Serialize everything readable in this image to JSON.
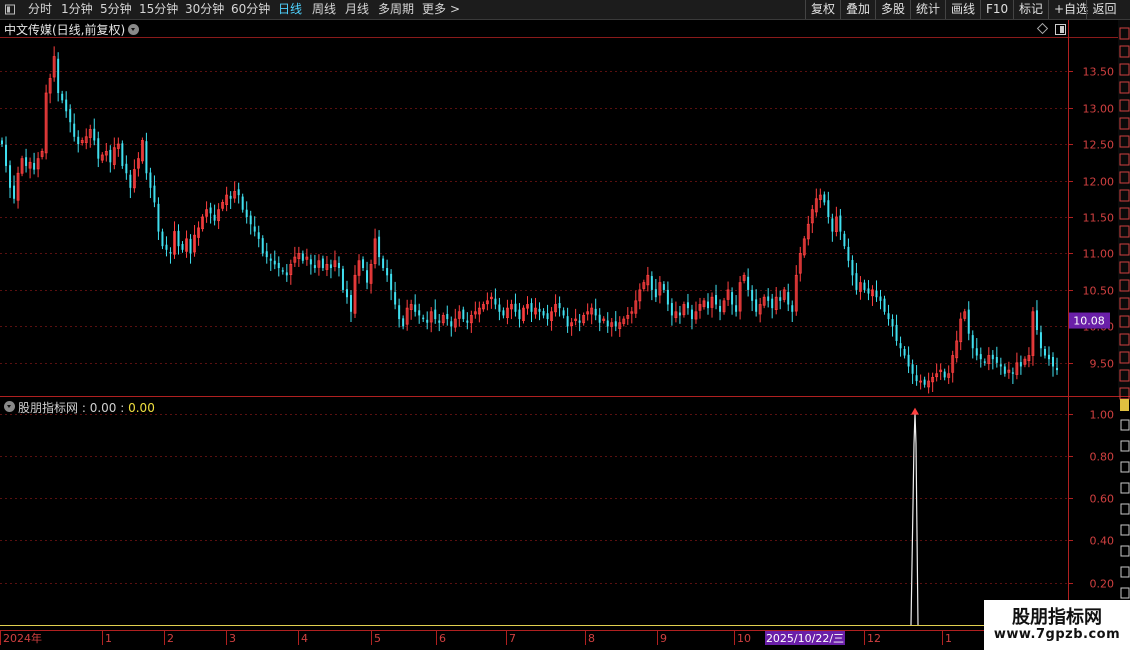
{
  "toolbar": {
    "periods": [
      {
        "label": "分时",
        "active": false
      },
      {
        "label": "1分钟",
        "active": false
      },
      {
        "label": "5分钟",
        "active": false
      },
      {
        "label": "15分钟",
        "active": false
      },
      {
        "label": "30分钟",
        "active": false
      },
      {
        "label": "60分钟",
        "active": false
      },
      {
        "label": "日线",
        "active": true
      },
      {
        "label": "周线",
        "active": false
      },
      {
        "label": "月线",
        "active": false
      },
      {
        "label": "多周期",
        "active": false
      },
      {
        "label": "更多",
        "active": false
      }
    ],
    "more_arrow": ">",
    "actions": [
      "复权",
      "叠加",
      "多股",
      "统计",
      "画线",
      "F10",
      "标记",
      "+自选",
      "返回"
    ]
  },
  "stock": {
    "title": "中文传媒(日线,前复权)"
  },
  "price_axis": {
    "ticks": [
      "13.50",
      "13.00",
      "12.50",
      "12.00",
      "11.50",
      "11.00",
      "10.50",
      "10.00",
      "9.50"
    ],
    "current_price": "10.08"
  },
  "indicator": {
    "name": "股朋指标网",
    "value1": "0.00",
    "value2": "0.00",
    "ticks": [
      "1.00",
      "0.80",
      "0.60",
      "0.40",
      "0.20"
    ]
  },
  "time_axis": {
    "labels": [
      "2024年",
      "1",
      "2",
      "3",
      "4",
      "5",
      "6",
      "7",
      "8",
      "9",
      "10",
      "12",
      "1"
    ],
    "cursor_date": "2025/10/22/三"
  },
  "watermark": {
    "title": "股朋指标网",
    "url": "www.7gpzb.com"
  },
  "colors": {
    "up": "#ff4040",
    "down": "#40e0f0",
    "grid": "#5a1010",
    "axis": "#b02020",
    "highlight": "#6a1fa8",
    "arrow": "#ff4040"
  },
  "chart_data": {
    "type": "candlestick",
    "price_range": [
      9.1,
      13.9
    ],
    "price_ticks": [
      13.5,
      13.0,
      12.5,
      12.0,
      11.5,
      11.0,
      10.5,
      10.0,
      9.5
    ],
    "last_price": 10.08,
    "closes": [
      12.5,
      12.2,
      11.9,
      11.75,
      12.1,
      12.3,
      12.2,
      12.25,
      12.15,
      12.3,
      12.4,
      13.2,
      13.4,
      13.7,
      13.2,
      13.1,
      12.95,
      12.8,
      12.6,
      12.5,
      12.55,
      12.6,
      12.7,
      12.55,
      12.3,
      12.35,
      12.4,
      12.25,
      12.45,
      12.5,
      12.2,
      12.1,
      11.9,
      12.15,
      12.3,
      12.55,
      12.1,
      11.9,
      11.7,
      11.3,
      11.1,
      11.05,
      11.0,
      11.3,
      11.1,
      11.05,
      11.2,
      11.0,
      11.25,
      11.35,
      11.5,
      11.6,
      11.55,
      11.45,
      11.6,
      11.7,
      11.8,
      11.75,
      11.85,
      11.8,
      11.6,
      11.5,
      11.4,
      11.3,
      11.2,
      11.0,
      10.95,
      10.9,
      10.85,
      10.8,
      10.75,
      10.7,
      10.85,
      10.95,
      11.0,
      10.9,
      10.95,
      10.85,
      10.8,
      10.9,
      10.8,
      10.85,
      10.8,
      10.9,
      10.8,
      10.5,
      10.4,
      10.2,
      10.7,
      10.9,
      10.8,
      10.6,
      10.85,
      11.2,
      10.95,
      10.8,
      10.7,
      10.5,
      10.3,
      10.1,
      10.0,
      10.25,
      10.3,
      10.2,
      10.15,
      10.1,
      10.05,
      10.2,
      10.1,
      10.05,
      10.15,
      10.1,
      10.0,
      10.1,
      10.2,
      10.1,
      10.05,
      10.15,
      10.2,
      10.25,
      10.3,
      10.35,
      10.4,
      10.3,
      10.2,
      10.15,
      10.25,
      10.3,
      10.2,
      10.1,
      10.25,
      10.3,
      10.2,
      10.25,
      10.2,
      10.15,
      10.1,
      10.2,
      10.3,
      10.25,
      10.15,
      10.0,
      10.05,
      10.1,
      10.05,
      10.15,
      10.2,
      10.25,
      10.15,
      10.05,
      10.1,
      10.0,
      10.05,
      10.0,
      10.05,
      10.1,
      10.15,
      10.2,
      10.35,
      10.5,
      10.6,
      10.7,
      10.5,
      10.4,
      10.6,
      10.5,
      10.3,
      10.15,
      10.2,
      10.15,
      10.3,
      10.25,
      10.1,
      10.2,
      10.3,
      10.35,
      10.25,
      10.4,
      10.3,
      10.2,
      10.35,
      10.5,
      10.3,
      10.2,
      10.6,
      10.7,
      10.5,
      10.35,
      10.2,
      10.3,
      10.4,
      10.35,
      10.25,
      10.4,
      10.35,
      10.5,
      10.3,
      10.2,
      10.7,
      11.0,
      11.2,
      11.4,
      11.6,
      11.75,
      11.8,
      11.7,
      11.5,
      11.3,
      11.5,
      11.3,
      11.1,
      10.9,
      10.7,
      10.5,
      10.6,
      10.5,
      10.45,
      10.5,
      10.4,
      10.35,
      10.2,
      10.1,
      10.0,
      9.8,
      9.7,
      9.6,
      9.45,
      9.35,
      9.25,
      9.25,
      9.2,
      9.25,
      9.3,
      9.35,
      9.4,
      9.3,
      9.35,
      9.6,
      9.8,
      10.1,
      10.2,
      9.9,
      9.7,
      9.6,
      9.55,
      9.5,
      9.6,
      9.55,
      9.5,
      9.45,
      9.35,
      9.4,
      9.35,
      9.5,
      9.45,
      9.55,
      9.6,
      10.2,
      9.95,
      9.7,
      9.6,
      9.55,
      9.45,
      9.4
    ],
    "indicator_signal": {
      "value": 1.0,
      "range": [
        0,
        1.05
      ]
    },
    "indicator_ticks": [
      1.0,
      0.8,
      0.6,
      0.4,
      0.2
    ]
  }
}
